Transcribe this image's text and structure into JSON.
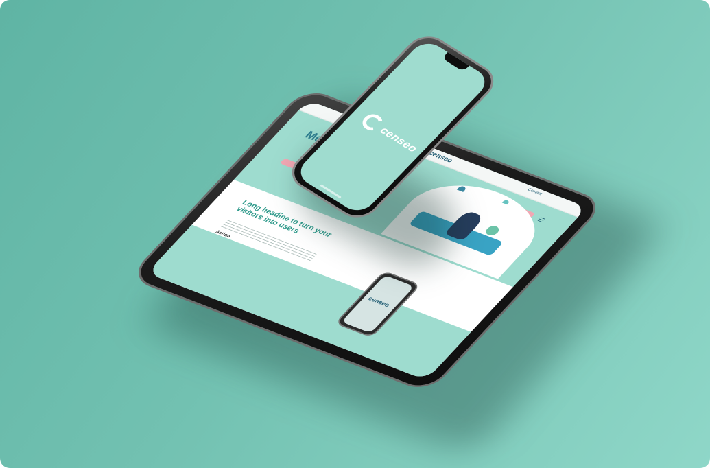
{
  "brand": {
    "name": "censeo",
    "colors": {
      "background": "#6fbdad",
      "screen_mint": "#9edccf",
      "accent_pink": "#f2a7b3",
      "heading_teal": "#2f9a8b",
      "navy": "#245f75",
      "device_black": "#151515"
    }
  },
  "tablet": {
    "hero": {
      "logo": "censeo",
      "title": "Med… disp…",
      "nav_contact": "Contact"
    },
    "section": {
      "heading": "Long headine to turn your visitors into users",
      "action_label": "Action"
    },
    "mini_phone": {
      "logo": "censeo"
    }
  },
  "phone": {
    "logo": "censeo",
    "logo_icon": "censeo-c-icon"
  }
}
